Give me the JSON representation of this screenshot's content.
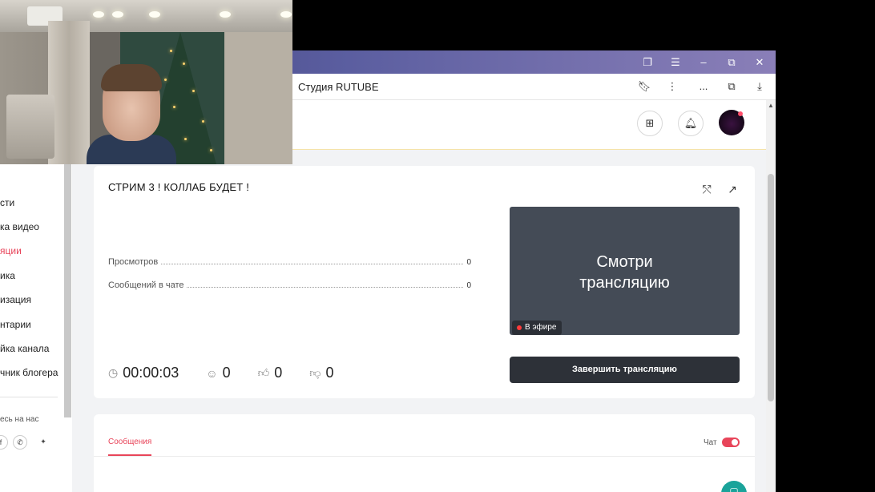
{
  "browser": {
    "tab_title": "Студия RUTUBE",
    "window_buttons": [
      "collections-icon",
      "menu-icon",
      "minimize-icon",
      "restore-icon",
      "close-icon"
    ],
    "address_icons": [
      "bookmark-icon",
      "more-icon",
      "ellipsis-icon",
      "extensions-icon",
      "download-icon"
    ],
    "ellipsis_label": "..."
  },
  "header": {
    "icons": [
      "add-icon",
      "bell-icon",
      "avatar"
    ],
    "accent_color": "#e8455a"
  },
  "sidebar": {
    "items": [
      {
        "label": "сти",
        "active": false
      },
      {
        "label": "ка видео",
        "active": false
      },
      {
        "label": "яции",
        "active": true
      },
      {
        "label": "ика",
        "active": false
      },
      {
        "label": "изация",
        "active": false
      },
      {
        "label": "нтарии",
        "active": false
      },
      {
        "label": "йка канала",
        "active": false
      },
      {
        "label": "чник блогера",
        "active": false
      }
    ],
    "follow_label": "есь на нас",
    "social_icons": [
      "vk-icon",
      "viber-icon",
      "plus-icon"
    ]
  },
  "stream": {
    "title": "СТРИМ 3 ! КОЛЛАБ БУДЕТ !",
    "stats": [
      {
        "label": "Просмотров",
        "value": "0"
      },
      {
        "label": "Сообщений в чате",
        "value": "0"
      }
    ],
    "duration": "00:00:03",
    "viewers": "0",
    "likes": "0",
    "dislikes": "0",
    "preview_text_line1": "Смотри",
    "preview_text_line2": "трансляцию",
    "live_badge": "В эфире",
    "end_button": "Завершить трансляцию"
  },
  "messages": {
    "tab_label": "Сообщения",
    "chat_label": "Чат",
    "chat_enabled": true
  }
}
